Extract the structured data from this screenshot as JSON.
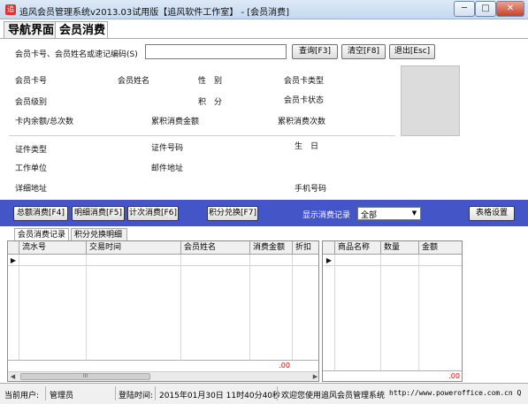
{
  "window": {
    "title": "追风会员管理系统v2013.03试用版【追风软件工作室】 - [会员消费]",
    "min_symbol": "─",
    "max_symbol": "□",
    "close_symbol": "✕",
    "icon_char": "追"
  },
  "nav_tabs": [
    "导航界面",
    "会员消费"
  ],
  "search": {
    "label": "会员卡号、会员姓名或速记编码(S)",
    "value": "",
    "query_btn": "查询[F3]",
    "clear_btn": "清空[F8]",
    "exit_btn": "退出[Esc]"
  },
  "member_fields": {
    "card_no": "会员卡号",
    "name": "会员姓名",
    "gender": "性　别",
    "card_type": "会员卡类型",
    "level": "会员级别",
    "points": "积　分",
    "card_status": "会员卡状态",
    "balance": "卡内余额/总次数",
    "total_amount": "累积消费金额",
    "total_count": "累积消费次数",
    "id_type": "证件类型",
    "id_no": "证件号码",
    "birthday": "生　日",
    "work_unit": "工作单位",
    "postcode": "邮件地址",
    "address": "详细地址",
    "mobile": "手机号码"
  },
  "toolbar": {
    "total_btn": "总额消费[F4]",
    "detail_btn": "明细消费[F5]",
    "count_btn": "计次消费[F6]",
    "points_btn": "积分兑换[F7]",
    "show_label": "显示消费记录",
    "show_value": "全部",
    "table_settings_btn": "表格设置"
  },
  "sub_tabs": [
    "会员消费记录",
    "积分兑换明细"
  ],
  "left_grid": {
    "columns": [
      "流水号",
      "交易时间",
      "会员姓名",
      "消费金额",
      "折扣"
    ],
    "total": ".00",
    "thumb_text": "III"
  },
  "right_grid": {
    "columns": [
      "商品名称",
      "数量",
      "金额"
    ],
    "total": ".00"
  },
  "status": {
    "user_label": "当前用户:",
    "user_value": "管理员",
    "login_label": "登陆时间:",
    "login_value": "2015年01月30日 11时40分40秒",
    "welcome": "欢迎您使用追风会员管理系统",
    "url": "http://www.poweroffice.com.cn Q"
  }
}
